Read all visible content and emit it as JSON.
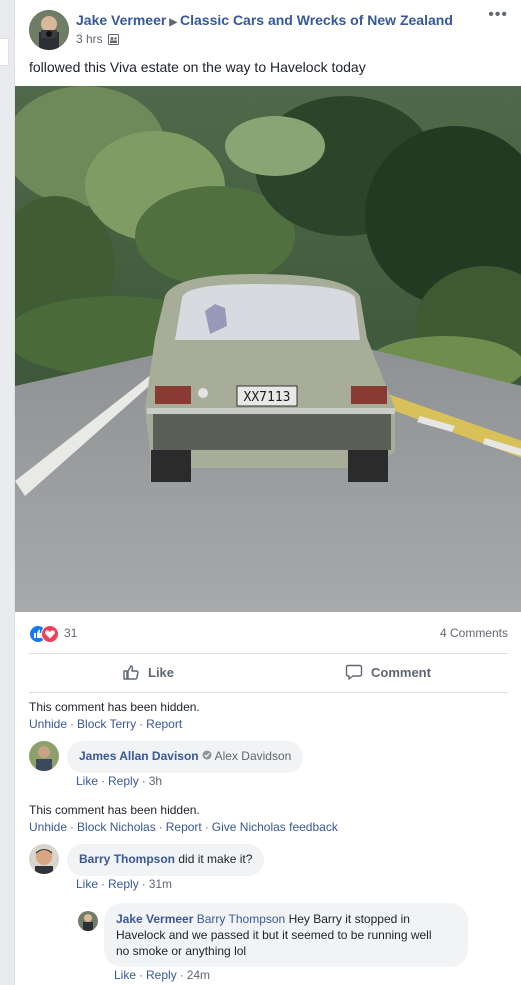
{
  "header": {
    "author": "Jake Vermeer",
    "group": "Classic Cars and Wrecks of New Zealand",
    "time": "3 hrs",
    "audience_icon": "group-icon"
  },
  "post": {
    "text": "followed this Viva estate on the way to Havelock today",
    "plate": "XX7113"
  },
  "reactions": {
    "count": "31",
    "comments": "4 Comments"
  },
  "actions": {
    "like": "Like",
    "comment": "Comment"
  },
  "comments": [
    {
      "hidden_text": "This comment has been hidden.",
      "links": [
        "Unhide",
        "Block Terry",
        "Report"
      ],
      "reply": {
        "author": "James Allan Davison",
        "tagged": "Alex Davidson",
        "actions": [
          "Like",
          "Reply"
        ],
        "time": "3h"
      }
    },
    {
      "hidden_text": "This comment has been hidden.",
      "links": [
        "Unhide",
        "Block Nicholas",
        "Report",
        "Give Nicholas feedback"
      ]
    },
    {
      "author": "Barry Thompson",
      "text": "did it make it?",
      "actions": [
        "Like",
        "Reply"
      ],
      "time": "31m",
      "reply": {
        "author": "Jake Vermeer",
        "tagged": "Barry Thompson",
        "text_lines": [
          "Hey Barry it stopped in",
          "Havelock and we passed it but it seemed to be running well",
          "no smoke or anything lol"
        ],
        "actions": [
          "Like",
          "Reply"
        ],
        "time": "24m"
      }
    }
  ]
}
